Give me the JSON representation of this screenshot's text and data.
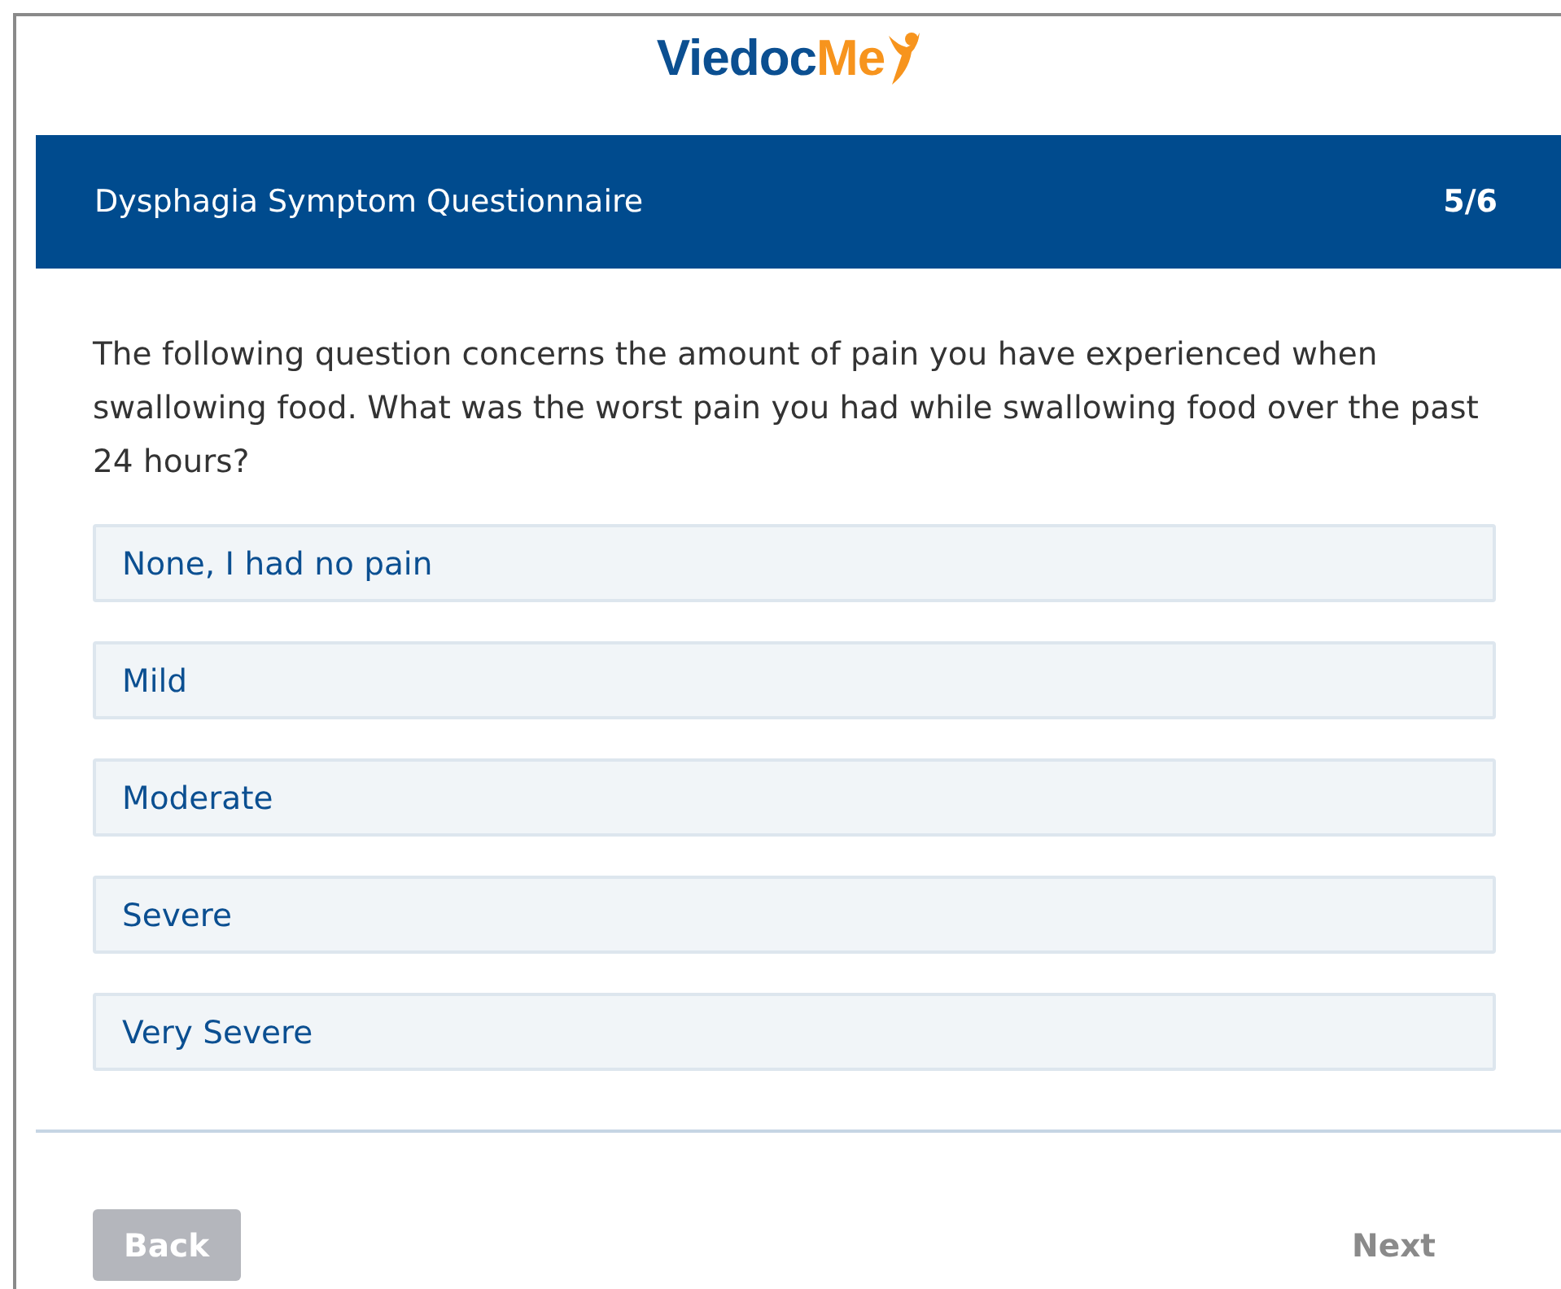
{
  "logo": {
    "part1": "Viedoc",
    "part2": "Me"
  },
  "header": {
    "title": "Dysphagia Symptom Questionnaire",
    "progress": "5/6"
  },
  "question": "The following question concerns the amount of pain you have experienced when swallowing food. What was the worst pain you had while swallowing food over the past 24 hours?",
  "options": [
    {
      "label": "None, I had no pain",
      "selected": false
    },
    {
      "label": "Mild",
      "selected": false
    },
    {
      "label": "Moderate",
      "selected": false
    },
    {
      "label": "Severe",
      "selected": false
    },
    {
      "label": "Very Severe",
      "selected": false
    }
  ],
  "buttons": [
    {
      "label": "Back",
      "kind": "back",
      "disabled": true
    },
    {
      "label": "Next",
      "kind": "next",
      "disabled": true
    }
  ]
}
